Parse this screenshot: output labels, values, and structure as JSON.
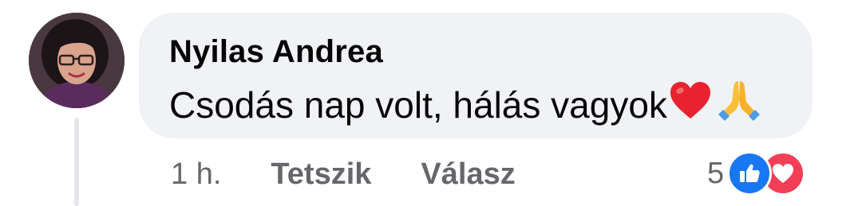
{
  "comment": {
    "author": "Nyilas Andrea",
    "text": "Csodás nap volt, hálás vagyok",
    "emojis": [
      "red-heart-icon",
      "folded-hands-icon"
    ]
  },
  "actions": {
    "time": "1 h.",
    "like_label": "Tetszik",
    "reply_label": "Válasz"
  },
  "reactions": {
    "count": "5",
    "types": [
      "like-icon",
      "love-icon"
    ]
  },
  "colors": {
    "bubble": "#f0f2f5",
    "secondary_text": "#65676b",
    "like_blue": "#1877f2",
    "love_red": "#f33e58"
  }
}
